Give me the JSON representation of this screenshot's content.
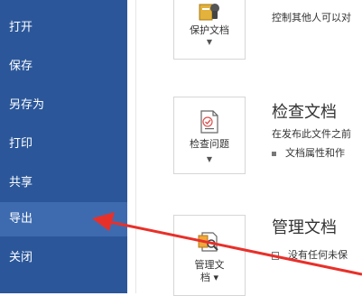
{
  "sidebar": {
    "items": [
      {
        "label": "打开"
      },
      {
        "label": "保存"
      },
      {
        "label": "另存为"
      },
      {
        "label": "打印"
      },
      {
        "label": "共享"
      },
      {
        "label": "导出"
      },
      {
        "label": "关闭"
      }
    ]
  },
  "sections": {
    "protect": {
      "button_label": "保护文档",
      "desc": "控制其他人可以对"
    },
    "inspect": {
      "button_label": "检查问题",
      "title": "检查文档",
      "desc": "在发布此文件之前",
      "bullet": "文档属性和作"
    },
    "manage": {
      "button_label_1": "管理文",
      "button_label_2": "档",
      "title": "管理文档",
      "bullet": "没有任何未保"
    }
  },
  "colors": {
    "sidebar": "#2b579a",
    "active": "#3e6bb0",
    "arrow": "#e8302a"
  }
}
